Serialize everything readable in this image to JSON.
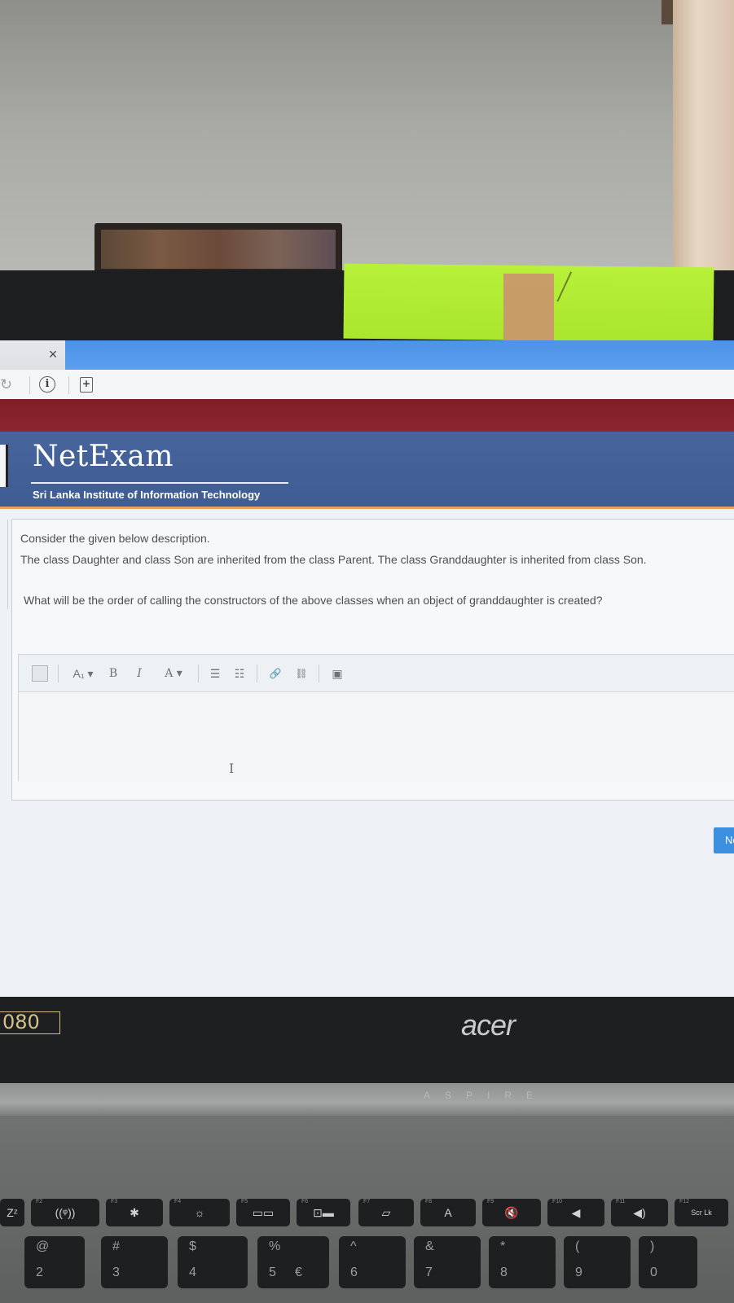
{
  "browser": {
    "tab_close": "×",
    "reload_icon": "↻",
    "info_icon": "i",
    "page_icon": "+"
  },
  "header": {
    "brand": "NetExam",
    "institute": "Sri Lanka Institute of Information Technology"
  },
  "question": {
    "line1": "Consider the given below description.",
    "line2": "The class Daughter and class Son are inherited from the class Parent. The class Granddaughter is inherited from class Son.",
    "line3": "What will be the order of calling the constructors of the above classes when an object of granddaughter is created?"
  },
  "editor": {
    "toolbar": {
      "font_size_label": "A₁ ▾",
      "bold_label": "B",
      "italic_label": "I",
      "text_color_label": "A ▾",
      "bullets_label": "☰",
      "numbering_label": "☷",
      "link_label": "🔗",
      "unlink_label": "⛓",
      "image_label": "▣"
    },
    "cursor": "I"
  },
  "next_button_label": "Ne",
  "laptop": {
    "model_badge": "080",
    "brand": "acer",
    "series": "ASPIRE"
  },
  "keyboard": {
    "fkeys": [
      {
        "fn": "F1",
        "sym": "Zᶻ"
      },
      {
        "fn": "F2",
        "sym": "((ᵠ))"
      },
      {
        "fn": "F3",
        "sym": "✱"
      },
      {
        "fn": "F4",
        "sym": "☼"
      },
      {
        "fn": "F5",
        "sym": "▭▭"
      },
      {
        "fn": "F6",
        "sym": "⊡▬"
      },
      {
        "fn": "F7",
        "sym": "▱"
      },
      {
        "fn": "F8",
        "sym": "A"
      },
      {
        "fn": "F9",
        "sym": "🔇"
      },
      {
        "fn": "F10",
        "sym": "◀"
      },
      {
        "fn": "F11",
        "sym": "◀)"
      },
      {
        "fn": "F12",
        "sym": "Scr Lk"
      }
    ],
    "numkeys": [
      {
        "top": "@",
        "bottom": "2",
        "alt": ""
      },
      {
        "top": "#",
        "bottom": "3",
        "alt": ""
      },
      {
        "top": "$",
        "bottom": "4",
        "alt": ""
      },
      {
        "top": "%",
        "bottom": "5",
        "alt": "€"
      },
      {
        "top": "^",
        "bottom": "6",
        "alt": ""
      },
      {
        "top": "&",
        "bottom": "7",
        "alt": ""
      },
      {
        "top": "*",
        "bottom": "8",
        "alt": ""
      },
      {
        "top": "(",
        "bottom": "9",
        "alt": ""
      },
      {
        "top": ")",
        "bottom": "0",
        "alt": ""
      }
    ]
  }
}
